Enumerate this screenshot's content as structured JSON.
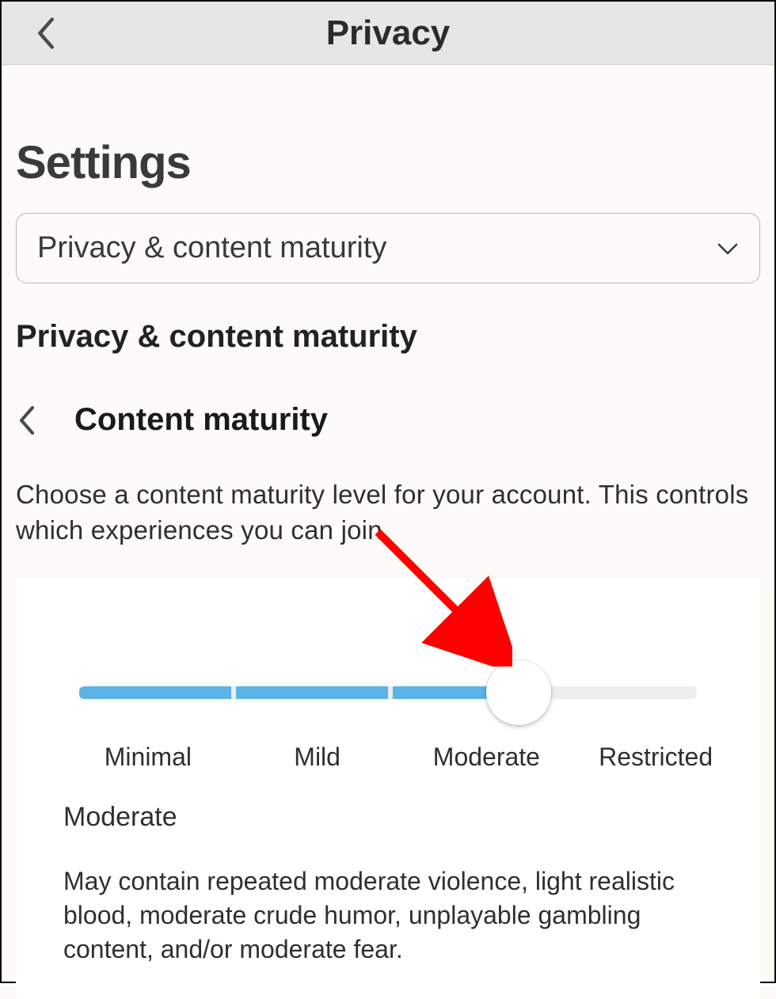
{
  "header": {
    "title": "Privacy"
  },
  "page_title": "Settings",
  "dropdown": {
    "label": "Privacy & content maturity"
  },
  "section_heading": "Privacy & content maturity",
  "sub_title": "Content maturity",
  "description": "Choose a content maturity level for your account. This controls which experiences you can join.",
  "slider": {
    "options": [
      "Minimal",
      "Mild",
      "Moderate",
      "Restricted"
    ],
    "selected_index": 2,
    "selected_label": "Moderate",
    "selected_description": "May contain repeated moderate violence, light realistic blood, moderate crude humor, unplayable gambling content, and/or moderate fear."
  }
}
